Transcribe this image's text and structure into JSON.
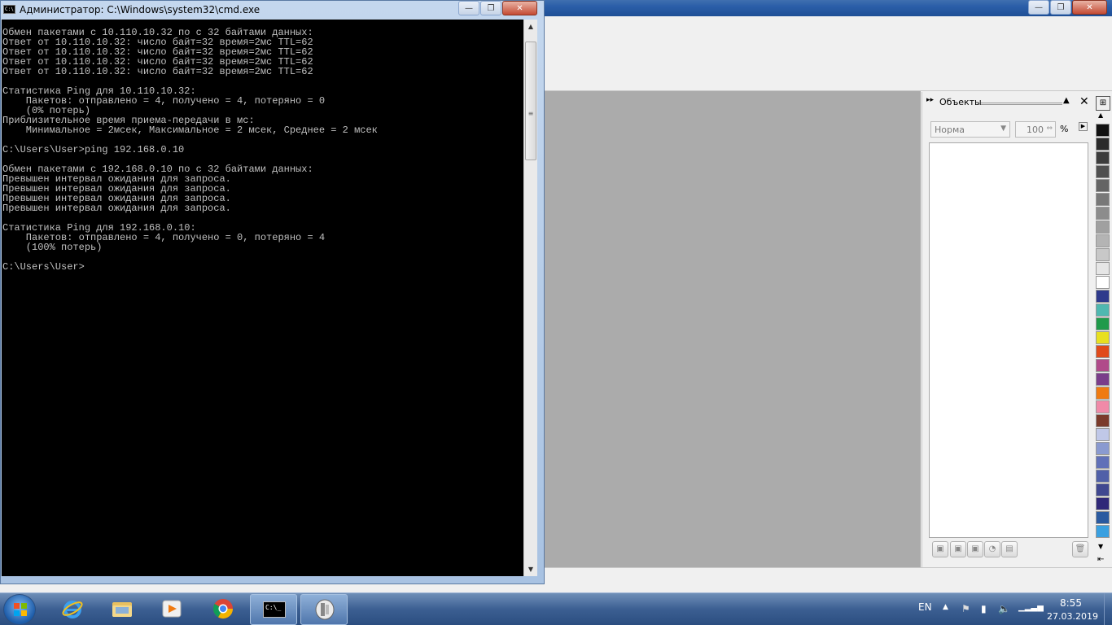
{
  "cmd": {
    "title": "Администратор: C:\\Windows\\system32\\cmd.exe",
    "icon_label": "C:\\",
    "lines": [
      "Обмен пакетами с 10.110.10.32 по с 32 байтами данных:",
      "Ответ от 10.110.10.32: число байт=32 время=2мс TTL=62",
      "Ответ от 10.110.10.32: число байт=32 время=2мс TTL=62",
      "Ответ от 10.110.10.32: число байт=32 время=2мс TTL=62",
      "Ответ от 10.110.10.32: число байт=32 время=2мс TTL=62",
      "",
      "Статистика Ping для 10.110.10.32:",
      "    Пакетов: отправлено = 4, получено = 4, потеряно = 0",
      "    (0% потерь)",
      "Приблизительное время приема-передачи в мс:",
      "    Минимальное = 2мсек, Максимальное = 2 мсек, Среднее = 2 мсек",
      "",
      "C:\\Users\\User>ping 192.168.0.10",
      "",
      "Обмен пакетами с 192.168.0.10 по с 32 байтами данных:",
      "Превышен интервал ожидания для запроса.",
      "Превышен интервал ожидания для запроса.",
      "Превышен интервал ожидания для запроса.",
      "Превышен интервал ожидания для запроса.",
      "",
      "Статистика Ping для 192.168.0.10:",
      "    Пакетов: отправлено = 4, получено = 0, потеряно = 4",
      "    (100% потерь)",
      "",
      "C:\\Users\\User>"
    ],
    "buttons": {
      "minimize": "—",
      "maximize": "❐",
      "close": "✕"
    }
  },
  "background_app": {
    "buttons": {
      "minimize": "—",
      "maximize": "❐",
      "close": "✕"
    },
    "docker": {
      "title": "Объекты",
      "blend_mode": "Норма",
      "opacity": "100",
      "percent": "%"
    },
    "palette_colors": [
      "#111111",
      "#2b2b2b",
      "#3d3d3d",
      "#505050",
      "#646464",
      "#787878",
      "#8c8c8c",
      "#a0a0a0",
      "#b4b4b4",
      "#c8c8c8",
      "#e6e6e6",
      "#ffffff",
      "#2e3a8c",
      "#4fb8b0",
      "#1f9a4a",
      "#e8e020",
      "#e04a1a",
      "#b04a8a",
      "#7a3d8a",
      "#f07a10",
      "#f08aa8",
      "#7a3a2a",
      "#c0c8e8",
      "#8a9ad0",
      "#6070b8",
      "#5060a8",
      "#404890",
      "#302878",
      "#2a5aa0",
      "#3aa0e0"
    ]
  },
  "taskbar": {
    "apps": [
      {
        "name": "internet-explorer"
      },
      {
        "name": "file-explorer"
      },
      {
        "name": "media-player"
      },
      {
        "name": "chrome"
      },
      {
        "name": "cmd",
        "label": "C:\\_"
      },
      {
        "name": "coreldraw"
      }
    ],
    "tray": {
      "language": "EN",
      "time": "8:55",
      "date": "27.03.2019"
    }
  }
}
